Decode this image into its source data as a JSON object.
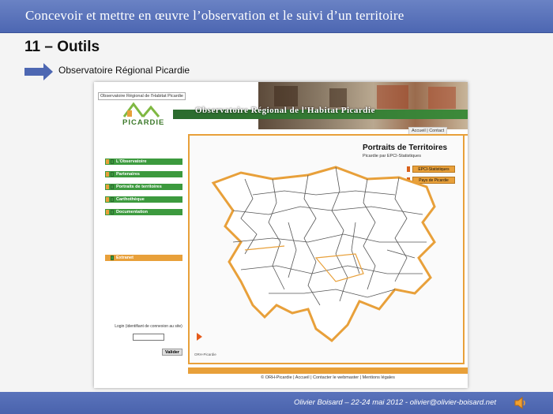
{
  "slide": {
    "header_title": "Concevoir et mettre en œuvre l’observation et le suivi d’un territoire",
    "section_title": "11 – Outils",
    "subtitle": "Observatoire Régional Picardie",
    "footer": "Olivier Boisard – 22-24 mai 2012 - olivier@olivier-boisard.net",
    "accent": "#4d67b2"
  },
  "website": {
    "banner_tag": "Observatoire Régional de l'Habitat Picardie",
    "banner_title": "Observatoire Régional de l'Habitat Picardie",
    "logo_text": "PICARDIE",
    "top_links": "Accueil | Contact",
    "menu": [
      "L'Observatoire",
      "Partenaires",
      "Portraits de territoires",
      "Carthothèque",
      "Documentation"
    ],
    "extranet": "Extranet",
    "login_label": "Login (identifiant de connexion au site)",
    "login_value": "",
    "validate_label": "Valider",
    "portraits_title": "Portraits de Territoires",
    "portraits_subtitle": "Picardie par EPCI-Statistiques",
    "buttons": [
      "EPCI-Statistiques",
      "Pays de Picardie"
    ],
    "map_caption": "ORH-Picardie",
    "footer_links": "© ORH-Picardie | Accueil | Contacter le webmaster | Mentions légales",
    "colors": {
      "green": "#3c9a3e",
      "orange": "#e8a03a"
    }
  }
}
